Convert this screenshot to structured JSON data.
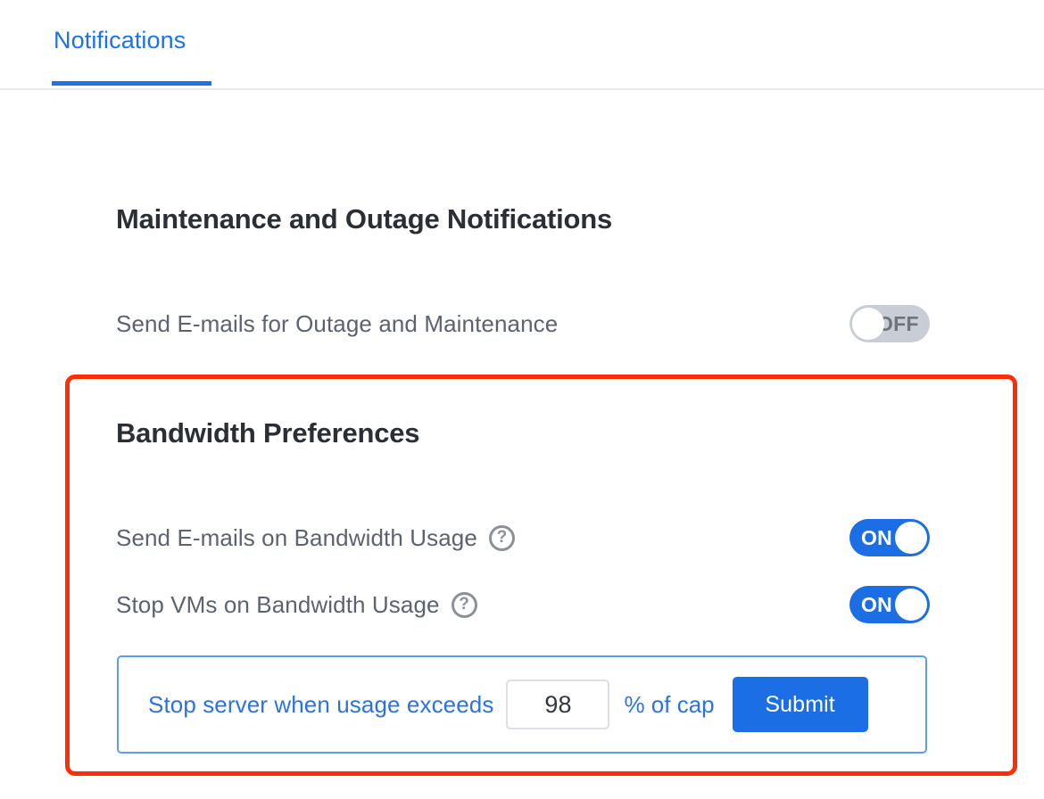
{
  "tabs": [
    {
      "label": "Notifications",
      "active": true
    }
  ],
  "sections": [
    {
      "id": "maintenance",
      "title": "Maintenance and Outage Notifications",
      "rows": [
        {
          "label": "Send E-mails for Outage and Maintenance",
          "has_help_icon": false,
          "toggle": {
            "state": "OFF",
            "label": "OFF"
          }
        }
      ]
    },
    {
      "id": "bandwidth",
      "title": "Bandwidth Preferences",
      "highlighted": true,
      "rows": [
        {
          "label": "Send E-mails on Bandwidth Usage",
          "has_help_icon": true,
          "help_icon_glyph": "?",
          "toggle": {
            "state": "ON",
            "label": "ON"
          }
        },
        {
          "label": "Stop VMs on Bandwidth Usage",
          "has_help_icon": true,
          "help_icon_glyph": "?",
          "toggle": {
            "state": "ON",
            "label": "ON"
          }
        }
      ],
      "threshold_form": {
        "prefix_label": "Stop server when usage exceeds",
        "value": "98",
        "placeholder": "",
        "suffix_label": "% of cap",
        "submit_label": "Submit"
      }
    }
  ],
  "colors": {
    "accent_blue": "#1b6ee3",
    "tab_blue": "#1a73e8",
    "link_blue": "#2a72e5",
    "panel_border_blue": "#5a9cf8",
    "toggle_off_grey": "#c9ced6",
    "text_grey": "#5b6270",
    "heading_dark": "#2a2f36",
    "highlight_red": "#fd2d05"
  }
}
